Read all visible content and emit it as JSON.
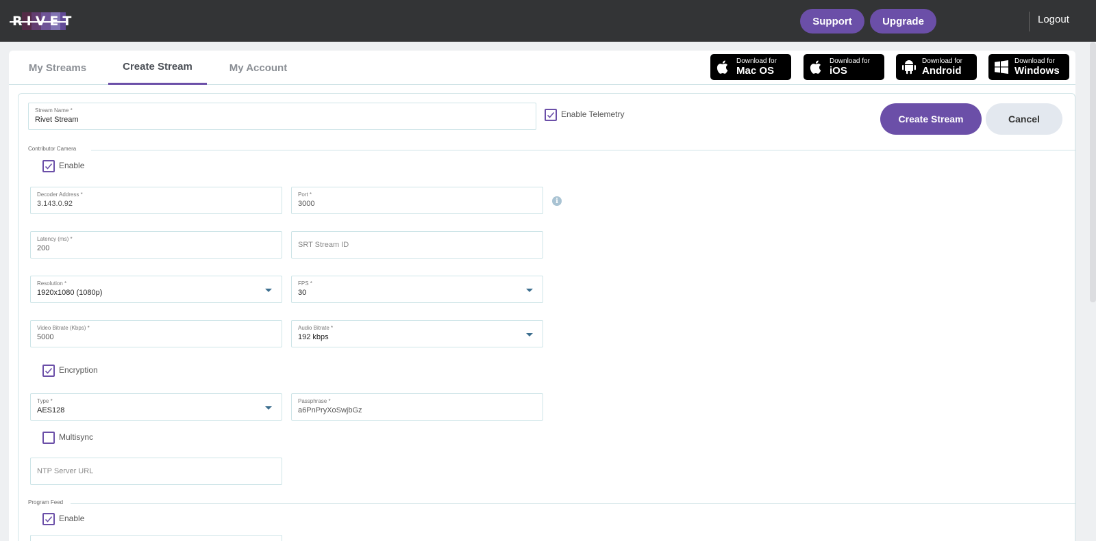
{
  "app": {
    "logo_text": "RIVET"
  },
  "header": {
    "support_label": "Support",
    "upgrade_label": "Upgrade",
    "logout_label": "Logout"
  },
  "tabs": [
    {
      "label": "My Streams"
    },
    {
      "label": "Create Stream"
    },
    {
      "label": "My Account"
    }
  ],
  "downloads": [
    {
      "small": "Download for",
      "big": "Mac OS",
      "icon": "apple-icon"
    },
    {
      "small": "Download for",
      "big": "iOS",
      "icon": "apple-icon"
    },
    {
      "small": "Download for",
      "big": "Android",
      "icon": "android-icon"
    },
    {
      "small": "Download for",
      "big": "Windows",
      "icon": "windows-icon"
    }
  ],
  "form": {
    "stream_name": {
      "label": "Stream Name *",
      "value": "Rivet Stream"
    },
    "enable_telemetry": {
      "label": "Enable Telemetry",
      "checked": true
    },
    "create_label": "Create Stream",
    "cancel_label": "Cancel",
    "contributor_camera": {
      "section_label": "Contributor Camera",
      "enable": {
        "label": "Enable",
        "checked": true
      },
      "decoder_address": {
        "label": "Decoder Address *",
        "value": "3.143.0.92"
      },
      "port": {
        "label": "Port *",
        "value": "3000"
      },
      "latency": {
        "label": "Latency (ms) *",
        "value": "200"
      },
      "srt_stream_id": {
        "placeholder": "SRT Stream ID"
      },
      "resolution": {
        "label": "Resolution *",
        "value": "1920x1080 (1080p)"
      },
      "fps": {
        "label": "FPS *",
        "value": "30"
      },
      "video_bitrate": {
        "label": "Video Bitrate (Kbps) *",
        "value": "5000"
      },
      "audio_bitrate": {
        "label": "Audio Bitrate *",
        "value": "192 kbps"
      },
      "encryption": {
        "label": "Encryption",
        "checked": true
      },
      "type": {
        "label": "Type *",
        "value": "AES128"
      },
      "passphrase": {
        "label": "Passphrase *",
        "value": "a6PnPryXoSwjbGz"
      },
      "multisync": {
        "label": "Multisync",
        "checked": false
      },
      "ntp_server": {
        "placeholder": "NTP Server URL"
      }
    },
    "program_feed": {
      "section_label": "Program Feed",
      "enable": {
        "label": "Enable",
        "checked": true
      }
    }
  },
  "colors": {
    "accent": "#6b4fa8",
    "topbar": "#333436",
    "border": "#cde4e7"
  }
}
